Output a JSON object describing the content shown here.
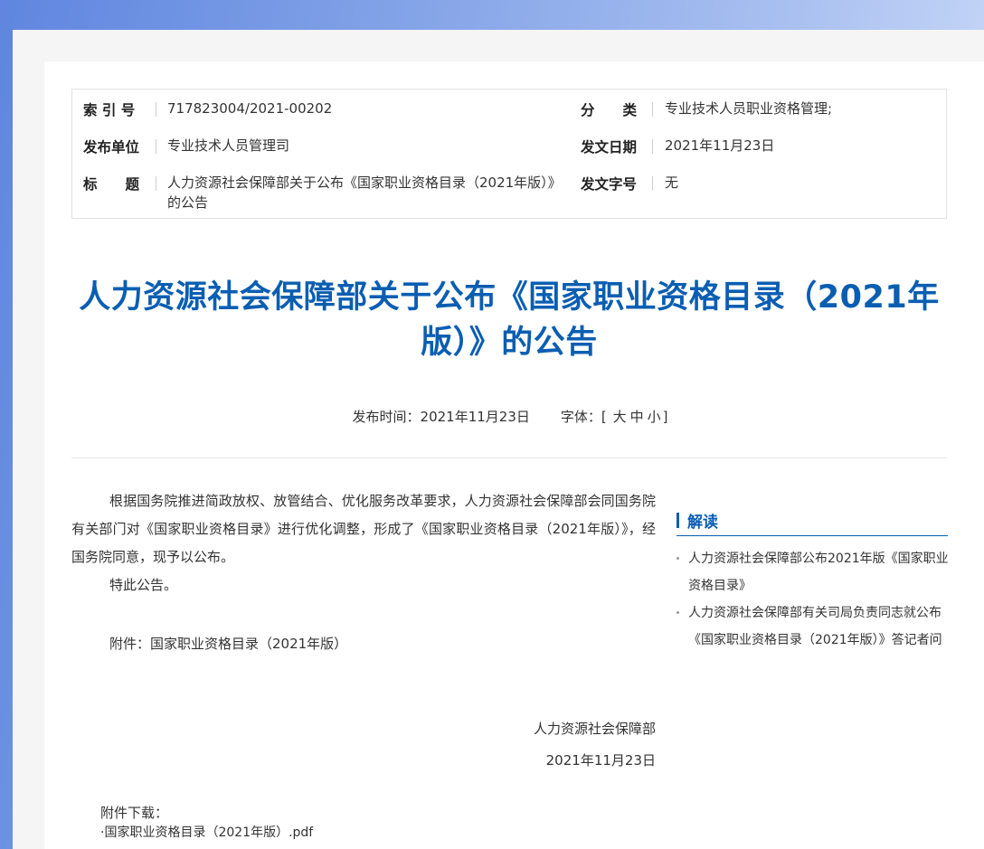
{
  "meta": {
    "index_no_label": "索 引 号",
    "index_no": "717823004/2021-00202",
    "category_label": "分　　类",
    "category": "专业技术人员职业资格管理;",
    "publisher_label": "发布单位",
    "publisher": "专业技术人员管理司",
    "issue_date_label": "发文日期",
    "issue_date": "2021年11月23日",
    "title_label": "标　　题",
    "title": "人力资源社会保障部关于公布《国家职业资格目录（2021年版）》的公告",
    "doc_no_label": "发文字号",
    "doc_no": "无"
  },
  "document": {
    "title": "人力资源社会保障部关于公布《国家职业资格目录（2021年版）》的公告",
    "publish_time_label": "发布时间：",
    "publish_time": "2021年11月23日",
    "font_label": "字体：",
    "font_open": "[",
    "font_large": "大",
    "font_medium": "中",
    "font_small": "小",
    "font_close": "]",
    "paragraph_1": "根据国务院推进简政放权、放管结合、优化服务改革要求，人力资源社会保障部会同国务院有关部门对《国家职业资格目录》进行优化调整，形成了《国家职业资格目录（2021年版）》，经国务院同意，现予以公布。",
    "paragraph_2": "特此公告。",
    "attachment_note": "附件：国家职业资格目录（2021年版）",
    "signature_org": "人力资源社会保障部",
    "signature_date": "2021年11月23日",
    "download_title": "附件下载：",
    "download_file": "·国家职业资格目录（2021年版）.pdf"
  },
  "sidebar": {
    "heading": "解读",
    "items": [
      {
        "label": "人力资源社会保障部公布2021年版《国家职业资格目录》"
      },
      {
        "label": "人力资源社会保障部有关司局负责同志就公布《国家职业资格目录（2021年版）》答记者问"
      }
    ]
  },
  "colors": {
    "accent": "#0a5eb2",
    "background_gradient_start": "#5f86e0",
    "background_gradient_end": "#d3e0fa"
  }
}
